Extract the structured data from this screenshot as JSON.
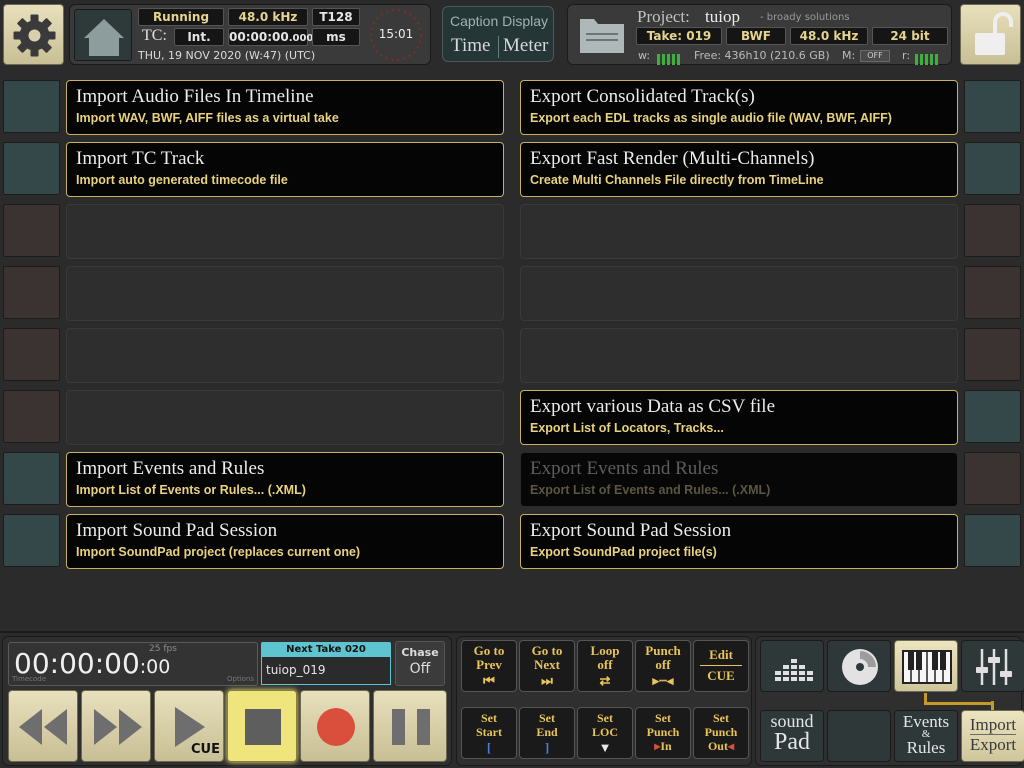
{
  "header": {
    "status": "Running",
    "sample_rate": "48.0 kHz",
    "track_count": "T128",
    "tc_label": "TC:",
    "tc_mode": "Int.",
    "tc_value": "00:00:00",
    "tc_frames": ".000",
    "tc_unit": "ms",
    "date": "THU, 19 NOV 2020 (W:47) (UTC)",
    "clock": "15:01",
    "caption_title": "Caption Display",
    "caption_time": "Time",
    "caption_meter": "Meter",
    "project_label": "Project:",
    "project_name": "tuiop",
    "project_sub": "- broady solutions",
    "take": "Take: 019",
    "format": "BWF",
    "project_rate": "48.0 kHz",
    "bit_depth": "24 bit",
    "w_label": "w:",
    "free": "Free: 436h10 (210.6 GB)",
    "m_label": "M:",
    "m_value": "OFF",
    "r_label": "r:"
  },
  "actions": {
    "import_audio": {
      "title": "Import Audio Files In Timeline",
      "desc": "Import WAV, BWF, AIFF files as a virtual take"
    },
    "import_tc": {
      "title": "Import TC Track",
      "desc": "Import auto generated timecode file"
    },
    "import_events": {
      "title": "Import Events and Rules",
      "desc": "Import List of Events or Rules... (.XML)"
    },
    "import_soundpad": {
      "title": "Import Sound Pad Session",
      "desc": "Import SoundPad project (replaces current one)"
    },
    "export_consolidated": {
      "title": "Export Consolidated Track(s)",
      "desc": "Export each EDL tracks as single audio file (WAV, BWF, AIFF)"
    },
    "export_fast_render": {
      "title": "Export Fast Render (Multi-Channels)",
      "desc": "Create Multi Channels File directly from TimeLine"
    },
    "export_csv": {
      "title": "Export various Data as CSV file",
      "desc": "Export List of Locators, Tracks..."
    },
    "export_events": {
      "title": "Export Events and Rules",
      "desc": "Export List of Events and Rules... (.XML)"
    },
    "export_soundpad": {
      "title": "Export Sound Pad Session",
      "desc": "Export SoundPad project file(s)"
    }
  },
  "transport": {
    "timecode": "00:00:00",
    "timecode_frames": ":00",
    "fps": "25 fps",
    "timecode_label": "Timecode",
    "options_label": "Options",
    "next_take_label": "Next Take 020",
    "next_take_name": "tuiop_019",
    "chase_label": "Chase",
    "chase_value": "Off",
    "cue_label": "CUE"
  },
  "controls": {
    "goto_prev": "Go to\nPrev",
    "goto_next": "Go to\nNext",
    "loop": "Loop\noff",
    "punch": "Punch\noff",
    "edit": "Edit",
    "edit_cue": "CUE",
    "set_start": "Set\nStart",
    "set_end": "Set\nEnd",
    "set_loc": "Set\nLOC",
    "set_punch_in": "Set\nPunch",
    "set_punch_in_suffix": "In",
    "set_punch_out": "Set\nPunch",
    "set_punch_out_suffix": "Out"
  },
  "modes": {
    "sound": "sound",
    "pad": "Pad",
    "events": "Events",
    "amp": "&",
    "rules": "Rules",
    "import": "Import",
    "export": "Export"
  },
  "colors": {
    "accent_gold": "#c9b05c",
    "desc_yellow": "#e9d27f",
    "next_take_cyan": "#5ec4cf",
    "record_red": "#d94f3c"
  }
}
